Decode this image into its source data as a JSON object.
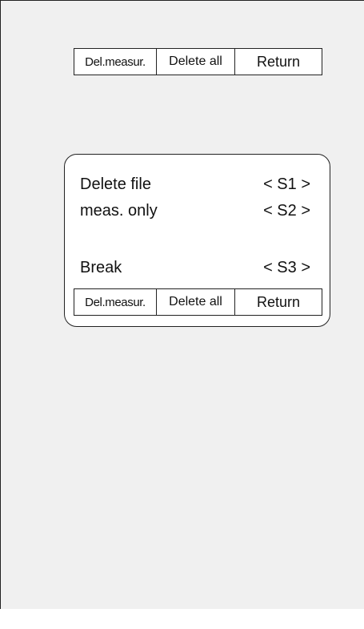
{
  "top_softkeys": {
    "del_measur": "Del.measur.",
    "delete_all": "Delete all",
    "return": "Return"
  },
  "dialog": {
    "options": [
      {
        "label": "Delete file",
        "key": "< S1 >"
      },
      {
        "label": "meas. only",
        "key": "< S2 >"
      },
      {
        "label": "Break",
        "key": "< S3 >"
      }
    ],
    "softkeys": {
      "del_measur": "Del.measur.",
      "delete_all": "Delete all",
      "return": "Return"
    }
  }
}
